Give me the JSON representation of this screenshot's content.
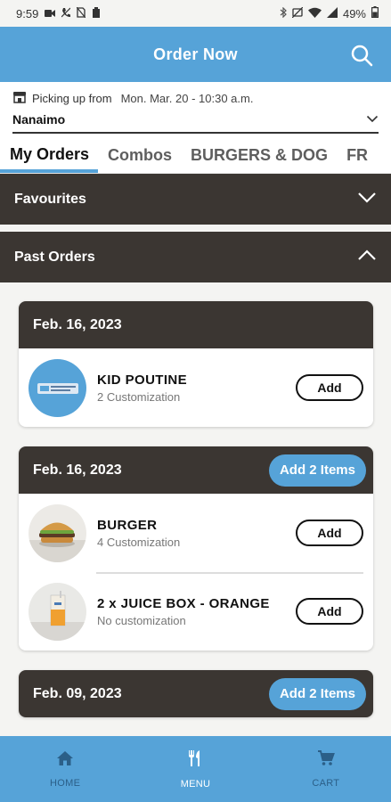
{
  "status_bar": {
    "time": "9:59",
    "battery": "49%"
  },
  "header": {
    "title": "Order Now"
  },
  "pickup": {
    "label": "Picking up from",
    "date": "Mon. Mar. 20 - 10:30 a.m.",
    "store": "Nanaimo"
  },
  "tabs": [
    "My Orders",
    "Combos",
    "BURGERS & DOG",
    "FR"
  ],
  "sections": {
    "favourites": "Favourites",
    "past_orders": "Past Orders"
  },
  "orders": [
    {
      "date": "Feb. 16, 2023",
      "items": [
        {
          "name": "KID POUTINE",
          "sub": "2 Customization",
          "add": "Add"
        }
      ]
    },
    {
      "date": "Feb. 16, 2023",
      "add_all": "Add 2 Items",
      "items": [
        {
          "name": "BURGER",
          "sub": "4 Customization",
          "add": "Add"
        },
        {
          "name": "2 x JUICE BOX - ORANGE",
          "sub": "No customization",
          "add": "Add"
        }
      ]
    },
    {
      "date": "Feb. 09, 2023",
      "add_all": "Add 2 Items"
    }
  ],
  "bottom_nav": {
    "home": "HOME",
    "menu": "MENU",
    "cart": "CART"
  },
  "colors": {
    "primary": "#56a3d8",
    "dark": "#3b3632"
  }
}
